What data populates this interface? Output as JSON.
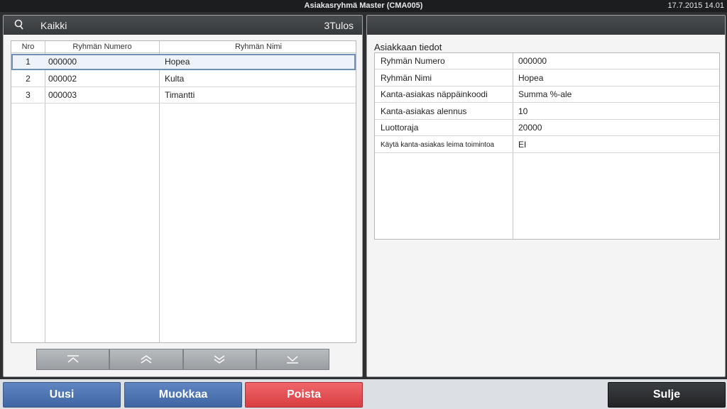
{
  "titlebar": {
    "title": "Asiakasryhmä Master (CMA005)",
    "clock": "17.7.2015 14.01"
  },
  "left_panel": {
    "filter": "Kaikki",
    "count": "3Tulos",
    "columns": [
      "Nro",
      "Ryhmän Numero",
      "Ryhmän Nimi"
    ],
    "rows": [
      {
        "nro": "1",
        "numero": "000000",
        "nimi": "Hopea"
      },
      {
        "nro": "2",
        "numero": "000002",
        "nimi": "Kulta"
      },
      {
        "nro": "3",
        "numero": "000003",
        "nimi": "Timantti"
      }
    ],
    "pager_icons": [
      "first-page-icon",
      "page-up-icon",
      "page-down-icon",
      "last-page-icon"
    ]
  },
  "right_panel": {
    "title": "Asiakkaan tiedot",
    "fields": [
      {
        "label": "Ryhmän Numero",
        "value": "000000"
      },
      {
        "label": "Ryhmän Nimi",
        "value": "Hopea"
      },
      {
        "label": "Kanta-asiakas näppäinkoodi",
        "value": "Summa %-ale"
      },
      {
        "label": "Kanta-asiakas alennus",
        "value": "10"
      },
      {
        "label": "Luottoraja",
        "value": "20000"
      },
      {
        "label": "Käytä kanta-asiakas leima toimintoa",
        "value": "EI"
      }
    ]
  },
  "buttons": {
    "new": "Uusi",
    "edit": "Muokkaa",
    "delete": "Poista",
    "close": "Sulje"
  },
  "colors": {
    "blue": "#4a72b0",
    "red": "#e2484c",
    "dark": "#2b2d30"
  }
}
